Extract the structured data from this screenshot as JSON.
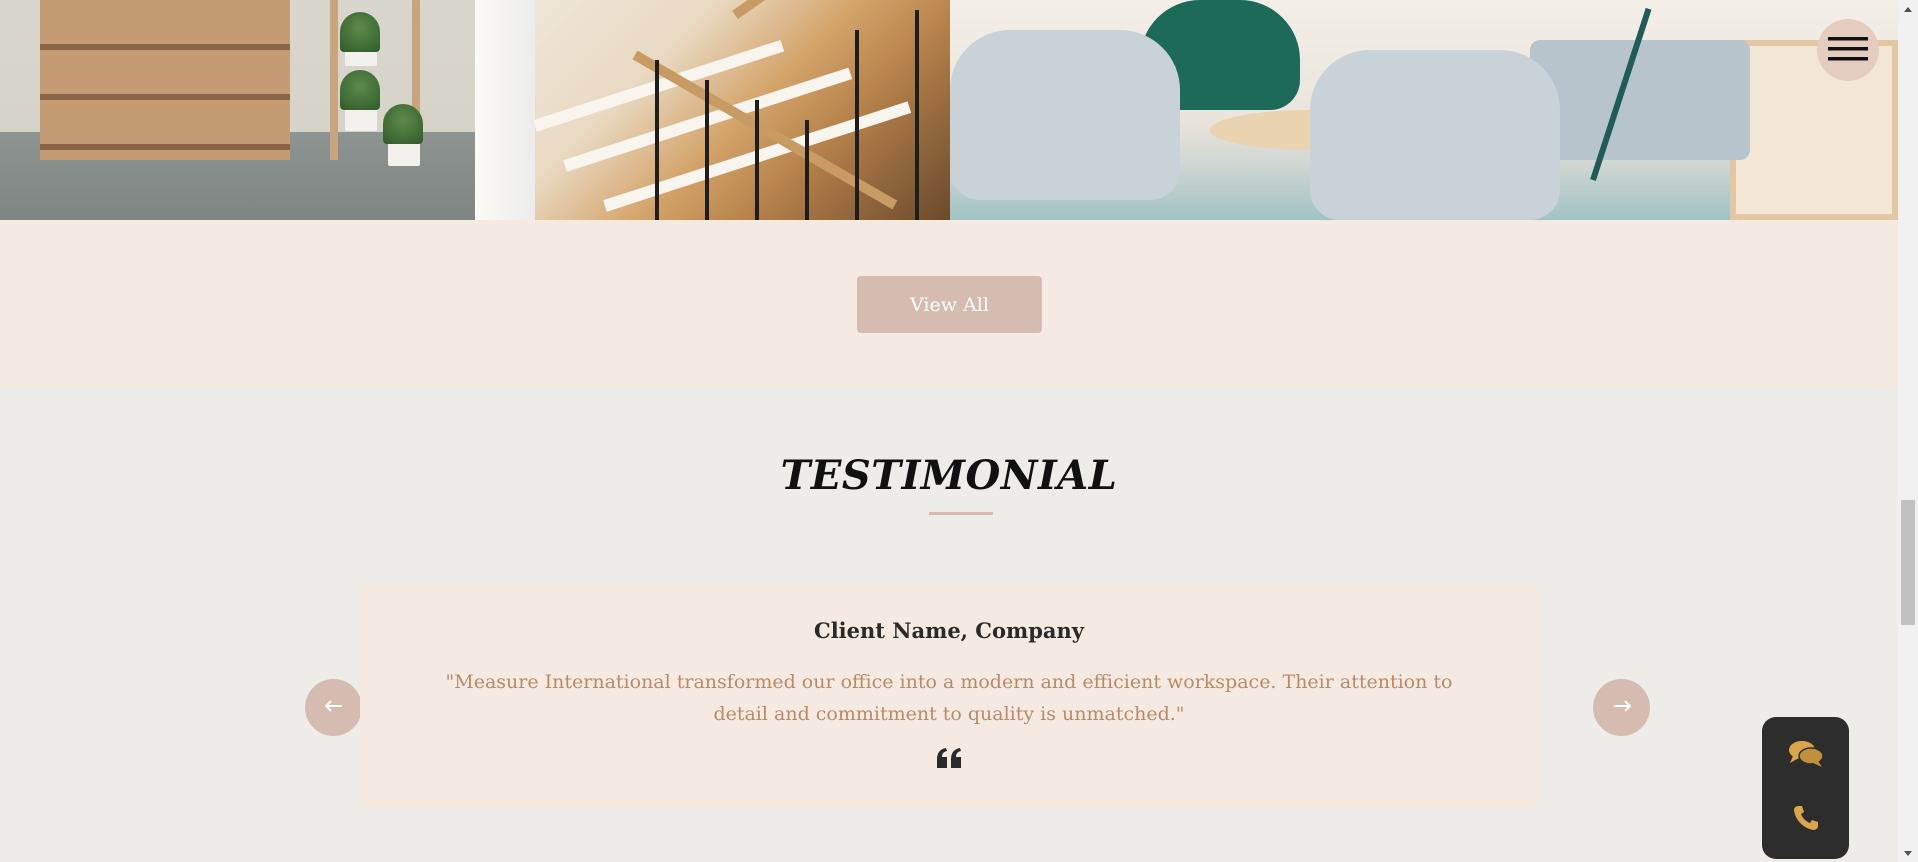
{
  "gallery": {
    "images": [
      {
        "subject": "bedroom with wooden dresser and plant shelf"
      },
      {
        "subject": "wooden staircase with black railing"
      },
      {
        "subject": "lounge with white chairs and sofa"
      }
    ]
  },
  "actions": {
    "view_all_label": "View All"
  },
  "testimonial": {
    "title": "TESTIMONIAL",
    "client_name": "Client Name, Company",
    "quote": "\"Measure International transformed our office into a modern and efficient workspace. Their attention to detail and commitment to quality is unmatched.\"",
    "prev_icon": "arrow-left-icon",
    "next_icon": "arrow-right-icon",
    "quote_icon": "quote-icon"
  },
  "menu": {
    "icon": "hamburger-icon"
  },
  "contact_widget": {
    "chat_icon": "chat-bubbles-icon",
    "phone_icon": "phone-icon"
  },
  "colors": {
    "accent": "#d6bcb0",
    "cream_band": "#f5eae2",
    "section_bg": "#edece8",
    "quote_text": "#b98a66",
    "widget_bg": "#2d2d2d",
    "widget_icon": "#d9a44a"
  }
}
